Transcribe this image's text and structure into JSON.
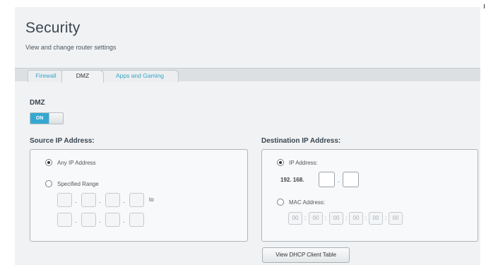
{
  "header": {
    "title": "Security",
    "subtitle": "View and change router settings"
  },
  "tabs": [
    {
      "label": "Firewall",
      "active": false
    },
    {
      "label": "DMZ",
      "active": true
    },
    {
      "label": "Apps and Gaming",
      "active": false
    }
  ],
  "dmz": {
    "section_title": "DMZ",
    "toggle_label": "ON",
    "enabled": true
  },
  "source": {
    "title": "Source IP Address:",
    "any_label": "Any IP Address",
    "range_label": "Specified Range",
    "to_label": "to",
    "selected": "any",
    "range_from": [
      "",
      "",
      "",
      ""
    ],
    "range_to": [
      "",
      "",
      "",
      ""
    ]
  },
  "destination": {
    "title": "Destination IP Address:",
    "ip_label": "IP Address:",
    "ip_prefix": "192. 168.",
    "mac_label": "MAC Address:",
    "selected": "ip",
    "mac_octets": [
      "00",
      "00",
      "00",
      "00",
      "00",
      "00"
    ]
  },
  "buttons": {
    "dhcp_table": "View DHCP Client Table"
  },
  "colors": {
    "accent": "#35a8d2",
    "tab_link": "#35a5c7",
    "panel_bg": "#f0f2f3",
    "title": "#3a4652"
  }
}
